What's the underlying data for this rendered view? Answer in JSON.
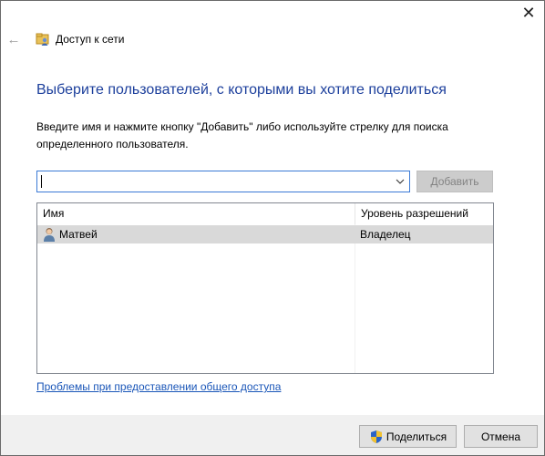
{
  "window": {
    "title": "Доступ к сети",
    "close_glyph": "✕",
    "back_glyph": "←"
  },
  "heading": "Выберите пользователей, с которыми вы хотите поделиться",
  "instruction": "Введите имя и нажмите кнопку \"Добавить\" либо используйте стрелку для поиска определенного пользователя.",
  "combo": {
    "value": "",
    "chevron_glyph": "⌵"
  },
  "add_button": {
    "label": "Добавить",
    "enabled": false
  },
  "list": {
    "columns": [
      "Имя",
      "Уровень разрешений"
    ],
    "rows": [
      {
        "name": "Матвей",
        "permission": "Владелец",
        "selected": true,
        "icon": "user-icon"
      }
    ]
  },
  "link": "Проблемы при предоставлении общего доступа",
  "footer": {
    "share_label": "Поделиться",
    "cancel_label": "Отмена"
  },
  "colors": {
    "heading": "#1c3f9c",
    "link": "#1a56b8",
    "selected_row": "#d9d9d9",
    "footer_bg": "#f0f0f0",
    "focus_border": "#3b7ad6"
  }
}
